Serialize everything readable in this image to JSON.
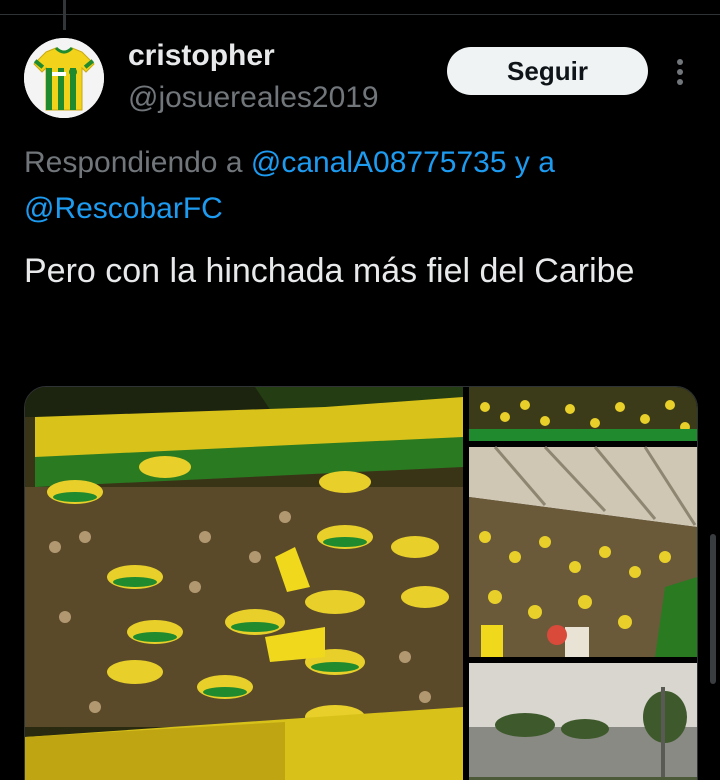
{
  "user": {
    "name": "cristopher",
    "handle": "@josuereales2019"
  },
  "actions": {
    "follow_label": "Seguir"
  },
  "reply_context": {
    "prefix": "Respondiendo a ",
    "mention_1": "@canalA08775735",
    "joiner": " y a",
    "mention_2": "@RescobarFC"
  },
  "tweet": {
    "text": "Pero con la hinchada más fiel del Caribe"
  },
  "colors": {
    "background": "#000000",
    "primary_text": "#e7e9ea",
    "secondary_text": "#71767b",
    "link": "#1d9bf0",
    "follow_button_bg": "#eff3f4",
    "team_yellow": "#f2d21a",
    "team_green": "#1f8a2e"
  },
  "icons": {
    "more": "more-vertical-icon",
    "avatar": "jersey-avatar"
  }
}
